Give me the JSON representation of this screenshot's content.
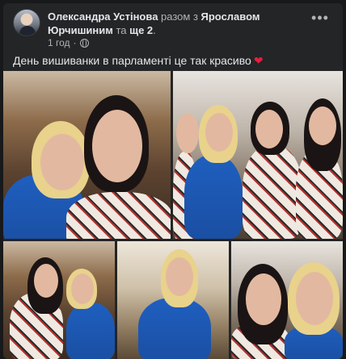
{
  "post": {
    "author": "Олександра Устінова",
    "with_text": " разом з ",
    "tagged": "Ярославом Юрчишиним",
    "and_text": " та ",
    "others": "ще 2",
    "period": ".",
    "time": "1 год",
    "privacy_icon": "globe-icon",
    "more_icon": "more-dots-icon",
    "text": "День вишиванки в парламенті це так красиво",
    "emoji": "❤",
    "emoji_color": "#e41e3f"
  },
  "colors": {
    "background": "#18191a",
    "card": "#242526",
    "primary_text": "#e4e6eb",
    "secondary_text": "#b0b3b8"
  },
  "photos": {
    "count": 5
  }
}
